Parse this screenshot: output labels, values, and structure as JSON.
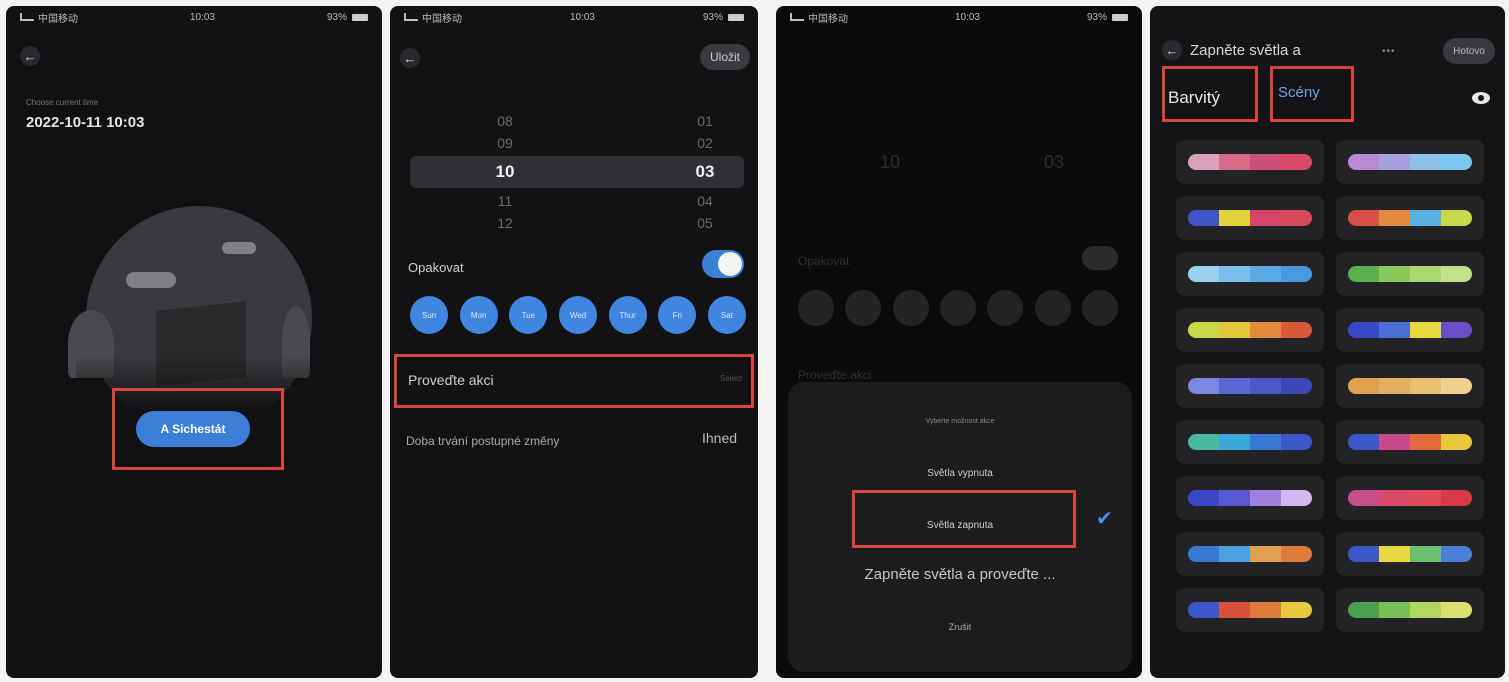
{
  "status": {
    "carrier": "中国移动",
    "time": "10:03",
    "battery": "93%"
  },
  "panel1": {
    "label": "Choose current time",
    "datetime": "2022-10-11 10:03",
    "button": "A Sichestát"
  },
  "panel2": {
    "save": "Uložit",
    "hours": [
      "08",
      "09",
      "10",
      "11",
      "12"
    ],
    "minutes": [
      "01",
      "02",
      "03",
      "04",
      "05"
    ],
    "repeat_label": "Opakovat",
    "repeat_on": true,
    "days": [
      "Sun",
      "Mon",
      "Tue",
      "Wed",
      "Thur",
      "Fri",
      "Sat"
    ],
    "action_label": "Proveďte akci",
    "action_value": "Select",
    "transition_label": "Doba trvání postupné změny",
    "transition_value": "Ihned"
  },
  "panel3": {
    "sheet_title": "Vyberte možnost akce",
    "option_off": "Světla vypnuta",
    "option_on": "Světla zapnuta",
    "caption": "Zapněte světla a proveďte ...",
    "cancel": "Zrušit"
  },
  "panel4": {
    "title": "Zapněte světla a",
    "dots": "•••",
    "done": "Hotovo",
    "tab_colorful": "Barvitý",
    "tab_scenes": "Scény",
    "swatches": [
      [
        "#d9a0b8",
        "#d86a8a",
        "#cc4f7a",
        "#d94a6a"
      ],
      [
        "#b88ad6",
        "#a6a0e0",
        "#8bc0ea",
        "#79c8f0"
      ],
      [
        "#3f55c8",
        "#e2d23a",
        "#d8456a",
        "#d84a5a"
      ],
      [
        "#d8504a",
        "#e08a3a",
        "#58b0e0",
        "#c8d84a"
      ],
      [
        "#9ad0f0",
        "#7ac0ee",
        "#5aaae8",
        "#4a98e0"
      ],
      [
        "#5ab04a",
        "#8ac85a",
        "#a8d870",
        "#c0e08a"
      ],
      [
        "#c8d84a",
        "#e0c83a",
        "#e08a3a",
        "#d85a3a"
      ],
      [
        "#3a48c8",
        "#4a70d8",
        "#e8d840",
        "#6a50c8"
      ],
      [
        "#7a88e0",
        "#5a68d8",
        "#4a58c8",
        "#3a48b8"
      ],
      [
        "#e0a050",
        "#e0b060",
        "#e8c070",
        "#f0d090"
      ],
      [
        "#4ab8a0",
        "#3aa8d8",
        "#3a78d8",
        "#3a58c8"
      ],
      [
        "#3a58c8",
        "#c84a8a",
        "#e06a3a",
        "#e8c83a"
      ],
      [
        "#3a48c8",
        "#5a58d0",
        "#a080e0",
        "#d0b8f0"
      ],
      [
        "#c8508a",
        "#d84a6a",
        "#e04a5a",
        "#d83a4a"
      ],
      [
        "#3a78d8",
        "#4aa0e0",
        "#e0a050",
        "#e07a3a"
      ],
      [
        "#3a58c8",
        "#e8d840",
        "#6ac070",
        "#4a80d8"
      ],
      [
        "#3a58c8",
        "#d8503a",
        "#e07a3a",
        "#e8c840"
      ],
      [
        "#4aa050",
        "#7ac058",
        "#b0d860",
        "#d8e070"
      ]
    ]
  }
}
